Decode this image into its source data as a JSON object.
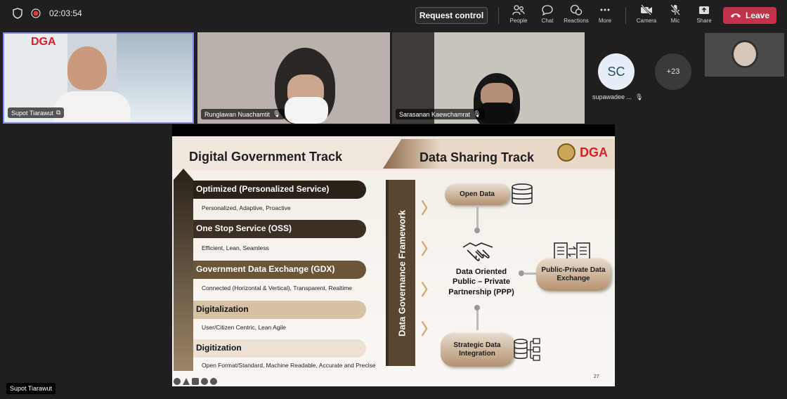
{
  "topbar": {
    "timer": "02:03:54",
    "request_control": "Request control",
    "tools": [
      "People",
      "Chat",
      "Reactions",
      "More",
      "Camera",
      "Mic",
      "Share"
    ],
    "leave": "Leave"
  },
  "participants": {
    "tile1": "Supot Tiarawut",
    "tile2": "Runglawan Nuachamtit",
    "tile3": "Sarasanan Kaewchamrat",
    "avatar_initials": "SC",
    "avatar_name": "supawadee ...",
    "overflow": "+23"
  },
  "presenter_label": "Supot Tiarawut",
  "slide": {
    "title_left": "Digital Government Track",
    "title_right": "Data Sharing Track",
    "logo_text": "DGA",
    "tracks": [
      {
        "title": "Optimized (Personalized Service)",
        "desc": "Personalized, Adaptive, Proactive",
        "color": "#2a2219"
      },
      {
        "title": "One Stop Service (OSS)",
        "desc": "Efficient, Lean, Seamless",
        "color": "#3a2f23"
      },
      {
        "title": "Government Data Exchange (GDX)",
        "desc": "Connected (Horizontal & Vertical), Transparent, Realtime",
        "color": "#6a5538"
      },
      {
        "title": "Digitalization",
        "desc": "User/Citizen Centric, Lean Agile",
        "color": "#d8c2a5"
      },
      {
        "title": "Digitization",
        "desc": "Open Format/Standard, Machine Readable, Accurate and Precise",
        "color": "#ece1d3"
      }
    ],
    "framework": "Data Governance Framework",
    "open_data": "Open Data",
    "ppp": "Data Oriented Public – Private Partnership (PPP)",
    "public_private": "Public-Private Data Exchange",
    "strategic": "Strategic Data Integration",
    "page": "27"
  }
}
